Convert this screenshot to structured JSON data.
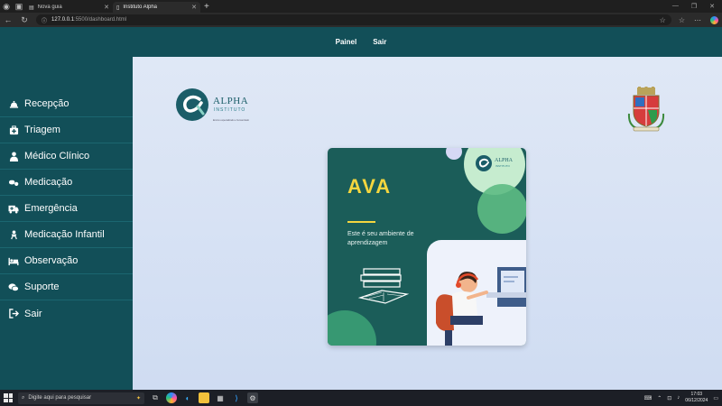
{
  "browser": {
    "tabs": [
      {
        "label": "Nova guia"
      },
      {
        "label": "Instituto Alpha"
      }
    ],
    "url_host": "127.0.0.1",
    "url_path": ":5500/dashboard.html"
  },
  "topnav": {
    "links": [
      {
        "label": "Painel"
      },
      {
        "label": "Sair"
      }
    ]
  },
  "sidebar": {
    "items": [
      {
        "label": "Recepção",
        "icon": "bell-icon"
      },
      {
        "label": "Triagem",
        "icon": "medkit-icon"
      },
      {
        "label": "Médico Clínico",
        "icon": "doctor-icon"
      },
      {
        "label": "Medicação",
        "icon": "pills-icon"
      },
      {
        "label": "Emergência",
        "icon": "ambulance-icon"
      },
      {
        "label": "Medicação Infantil",
        "icon": "baby-icon"
      },
      {
        "label": "Observação",
        "icon": "bed-icon"
      },
      {
        "label": "Suporte",
        "icon": "chat-icon"
      },
      {
        "label": "Sair",
        "icon": "logout-icon"
      }
    ]
  },
  "logo": {
    "name": "ALPHA",
    "sub": "INSTITUTO",
    "tagline": "Ensino especializado e humanizado"
  },
  "card": {
    "title": "AVA",
    "subtitle": "Este é seu ambiente de aprendizagem",
    "logo_name": "ALPHA",
    "logo_sub": "INSTITUTO"
  },
  "taskbar": {
    "search_placeholder": "Digite aqui para pesquisar",
    "time": "17:03",
    "date": "06/12/2024"
  },
  "colors": {
    "primary": "#124f58",
    "accent": "#f4d63f",
    "card_bg": "#1b5d59"
  }
}
